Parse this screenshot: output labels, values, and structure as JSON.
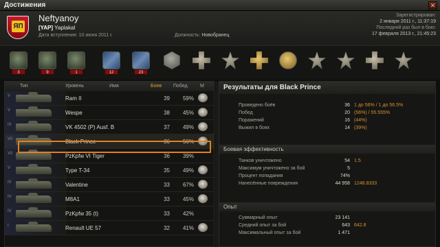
{
  "window": {
    "title": "Достижения",
    "close_icon": "close-icon"
  },
  "profile": {
    "name": "Neftyanoy",
    "clan_tag": "[YAP]",
    "clan_name": "Yaplakal",
    "join_date": "Дата вступления: 10 июня 2011 г.",
    "position_label": "Должность:",
    "position_value": "Новобранец",
    "registered_label": "Зарегистрирован:",
    "registered_value": "2 января 2011 г., 11:37:19",
    "last_seen_label": "Последний раз был в бою:",
    "last_seen_value": "17 февраля 2013 г., 21:45:23"
  },
  "medals": [
    {
      "icon": "tank-medal-icon",
      "count": "3"
    },
    {
      "icon": "tank-medal-icon",
      "count": "9"
    },
    {
      "icon": "tank-medal-icon",
      "count": "1"
    },
    {
      "icon": "blue-badge-icon",
      "count": "12"
    },
    {
      "icon": "blue-badge-icon",
      "count": "23"
    },
    {
      "icon": "hex-medal-icon",
      "count": ""
    },
    {
      "icon": "cross-medal-icon",
      "count": ""
    },
    {
      "icon": "star-medal-icon",
      "count": ""
    },
    {
      "icon": "cross-medal-icon",
      "count": ""
    },
    {
      "icon": "gold-medal-icon",
      "count": ""
    },
    {
      "icon": "star-medal-icon",
      "count": ""
    },
    {
      "icon": "star-medal-icon",
      "count": ""
    },
    {
      "icon": "cross-medal-icon",
      "count": ""
    },
    {
      "icon": "star-medal-icon",
      "count": ""
    }
  ],
  "table": {
    "headers": {
      "type": "Тип",
      "level": "Уровень",
      "name": "Имя",
      "battles": "Боев",
      "wins": "Побед",
      "mastery": "М"
    },
    "rows": [
      {
        "tier": "V",
        "name": "Ram II",
        "battles": "39",
        "wins": "59%"
      },
      {
        "tier": "V",
        "name": "Wespe",
        "battles": "38",
        "wins": "45%"
      },
      {
        "tier": "IX",
        "name": "VK 4502 (P) Ausf. B",
        "battles": "37",
        "wins": "49%"
      },
      {
        "tier": "VII",
        "name": "Black Prince",
        "battles": "36",
        "wins": "56%"
      },
      {
        "tier": "VII",
        "name": "PzKpfw VI Tiger",
        "battles": "36",
        "wins": "39%"
      },
      {
        "tier": "V",
        "name": "Type T-34",
        "battles": "35",
        "wins": "49%"
      },
      {
        "tier": "IV",
        "name": "Valentine",
        "battles": "33",
        "wins": "67%"
      },
      {
        "tier": "IV",
        "name": "M8A1",
        "battles": "33",
        "wins": "45%"
      },
      {
        "tier": "IV",
        "name": "PzKpfw 35 (t)",
        "battles": "33",
        "wins": "42%"
      },
      {
        "tier": "I",
        "name": "Renault UE 57",
        "battles": "32",
        "wins": "41%"
      }
    ]
  },
  "results": {
    "title": "Результаты для Black Prince",
    "general": [
      {
        "label": "Проведено боёв",
        "value": "36",
        "ext": "1 до 56% / 1 до 56.5%"
      },
      {
        "label": "Побед",
        "value": "20",
        "ext": "(56%)  /  55.555%"
      },
      {
        "label": "Поражений",
        "value": "16",
        "ext": "(44%)"
      },
      {
        "label": "Выжил в боях",
        "value": "14",
        "ext": "(39%)"
      }
    ],
    "combat_title": "Боевая эффективность",
    "combat": [
      {
        "label": "Танков уничтожено",
        "value": "54",
        "ext": "1.5"
      },
      {
        "label": "Максимум уничтожено за бой",
        "value": "5",
        "ext": ""
      },
      {
        "label": "Процент попадания",
        "value": "74%",
        "ext": ""
      },
      {
        "label": "Нанесённые повреждения",
        "value": "44 958",
        "ext": "1248.8333"
      }
    ],
    "exp_title": "Опыт",
    "exp": [
      {
        "label": "Суммарный опыт",
        "value": "23 141",
        "ext": ""
      },
      {
        "label": "Средний опыт за бой",
        "value": "643",
        "ext": "642.8"
      },
      {
        "label": "Максимальный опыт за бой",
        "value": "1 471",
        "ext": ""
      }
    ]
  }
}
